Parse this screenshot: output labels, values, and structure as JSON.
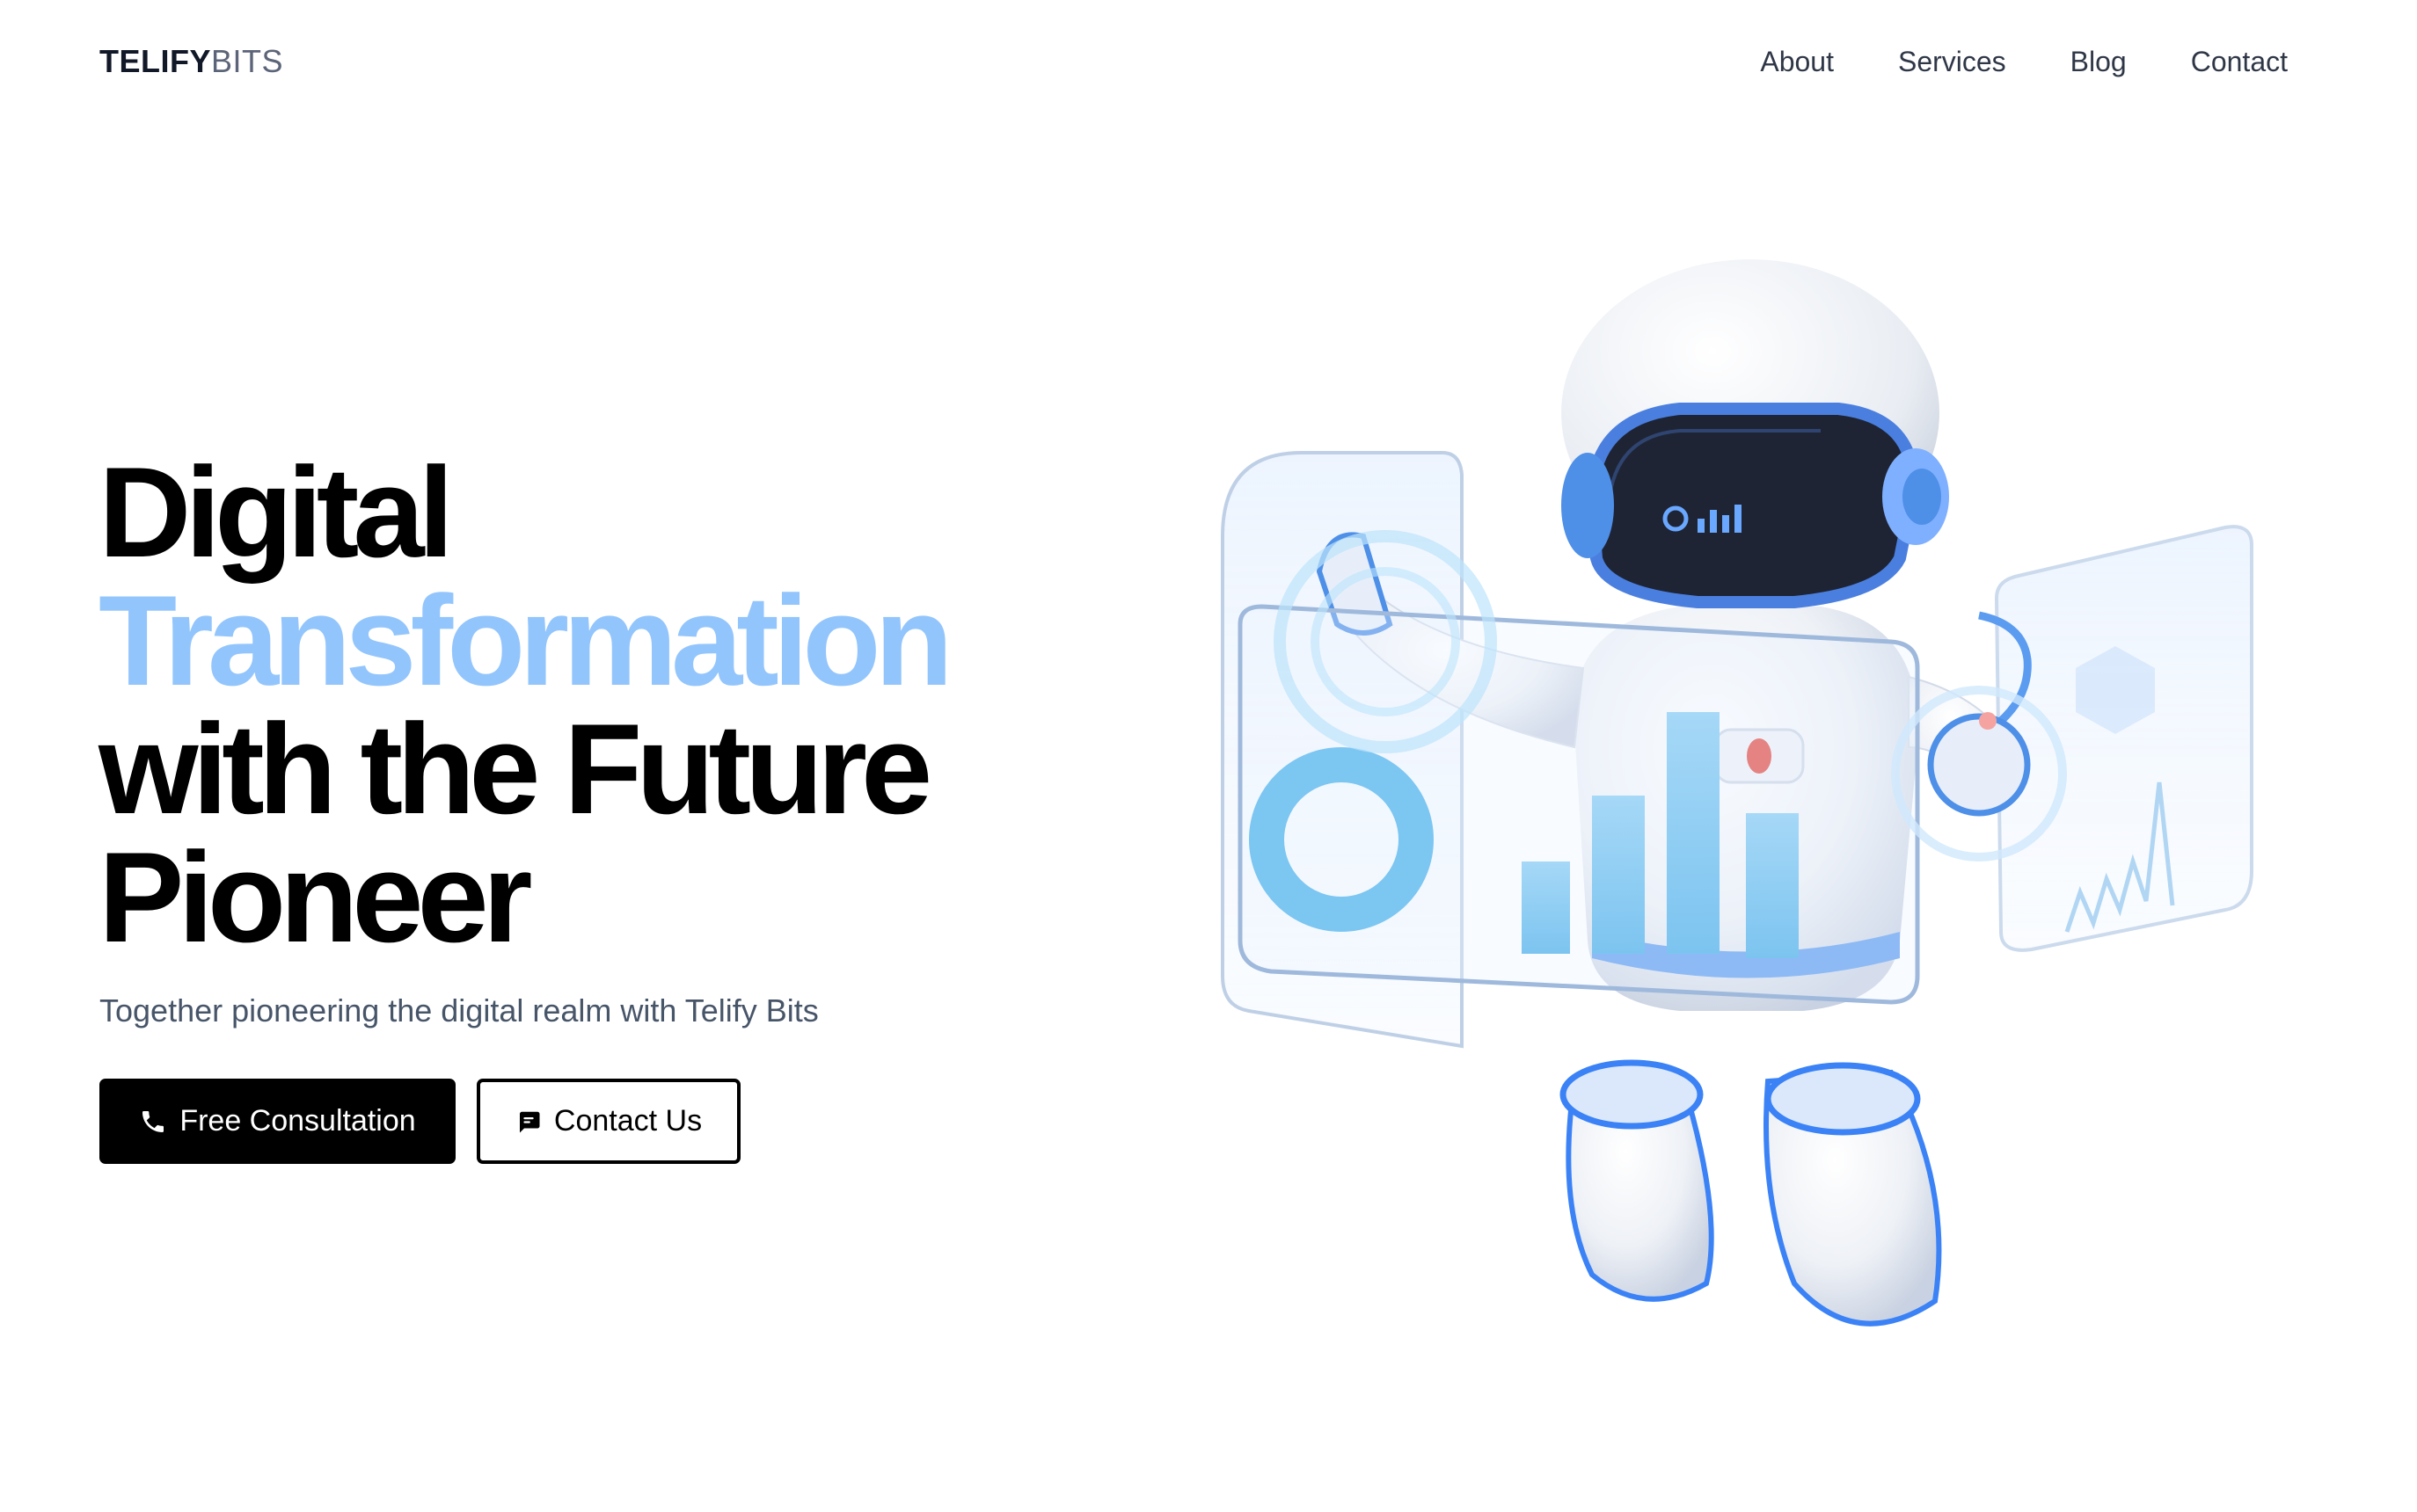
{
  "header": {
    "logo_bold": "TELIFY",
    "logo_light": "BITS",
    "nav": [
      {
        "label": "About"
      },
      {
        "label": "Services"
      },
      {
        "label": "Blog"
      },
      {
        "label": "Contact"
      }
    ]
  },
  "hero": {
    "title_line1": "Digital",
    "title_line2": "Transformation",
    "title_line3": "with the Future",
    "title_line4": "Pioneer",
    "subtitle": "Together pioneering the digital realm with Telify Bits",
    "primary_button": {
      "label": "Free Consultation",
      "icon": "phone-icon"
    },
    "secondary_button": {
      "label": "Contact Us",
      "icon": "chat-icon"
    }
  },
  "colors": {
    "accent": "#93c5fd",
    "primary_button_bg": "#000000",
    "text_muted": "#475569",
    "illustration_blue": "#3b82f6"
  },
  "illustration": {
    "icon": "astronaut-robot-illustration"
  }
}
